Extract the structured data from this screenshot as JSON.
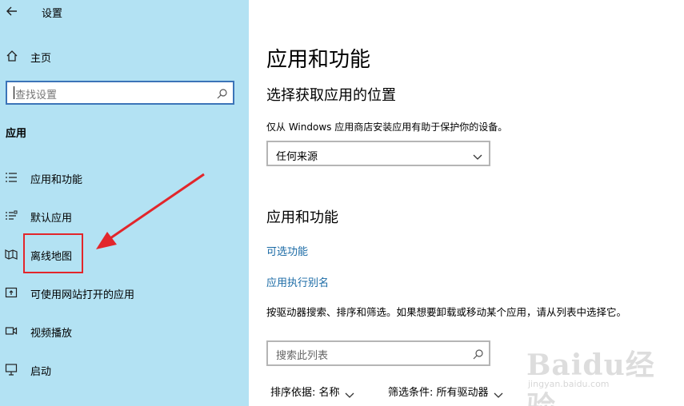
{
  "window": {
    "title": "设置"
  },
  "sidebar": {
    "home_label": "主页",
    "search_placeholder": "查找设置",
    "section_title": "应用",
    "items": [
      {
        "label": "应用和功能",
        "icon": "list-icon"
      },
      {
        "label": "默认应用",
        "icon": "default-apps-icon"
      },
      {
        "label": "离线地图",
        "icon": "map-icon"
      },
      {
        "label": "可使用网站打开的应用",
        "icon": "open-external-icon"
      },
      {
        "label": "视频播放",
        "icon": "video-icon"
      },
      {
        "label": "启动",
        "icon": "startup-icon"
      }
    ]
  },
  "main": {
    "title": "应用和功能",
    "source_heading": "选择获取应用的位置",
    "source_description": "仅从 Windows 应用商店安装应用有助于保护你的设备。",
    "source_dropdown_value": "任何来源",
    "apps_heading": "应用和功能",
    "links": [
      "可选功能",
      "应用执行别名"
    ],
    "instructions": "按驱动器搜索、排序和筛选。如果想要卸载或移动某个应用，请从列表中选择它。",
    "search_placeholder": "搜索此列表",
    "sort_label": "排序依据: 名称",
    "filter_label": "筛选条件: 所有驱动器"
  },
  "watermark": {
    "brand": "Baidu经验",
    "url": "jingyan.baidu.com"
  },
  "colors": {
    "sidebar_bg": "#b3e2f3",
    "link": "#1a6aa5",
    "highlight": "#e2262b",
    "search_border": "#3c74b8"
  }
}
